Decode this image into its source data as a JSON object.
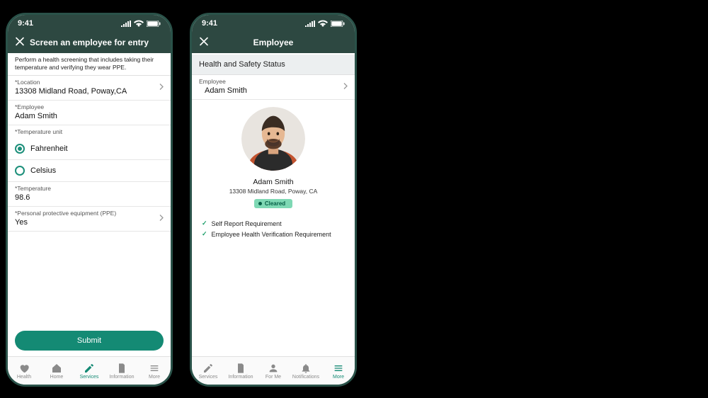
{
  "statusbar": {
    "time": "9:41"
  },
  "screen1": {
    "title": "Screen an employee for entry",
    "instructions": "Perform a health screening that includes taking their temperature and verifying they wear PPE.",
    "location_label": "*Location",
    "location_value": "13308 Midland Road, Poway,CA",
    "employee_label": "*Employee",
    "employee_value": "Adam Smith",
    "unit_label": "*Temperature unit",
    "unit_fahrenheit": "Fahrenheit",
    "unit_celsius": "Celsius",
    "temperature_label": "*Temperature",
    "temperature_value": "98.6",
    "ppe_label": "*Personal protective equipment (PPE)",
    "ppe_value": "Yes",
    "submit": "Submit",
    "tabs": {
      "health": "Health",
      "home": "Home",
      "services": "Services",
      "information": "Information",
      "more": "More"
    }
  },
  "screen2": {
    "title": "Employee",
    "section": "Health and Safety Status",
    "employee_label": "Employee",
    "employee_value": "Adam Smith",
    "profile_name": "Adam Smith",
    "profile_address": "13308 Midland Road, Poway, CA",
    "status": "Cleared",
    "req1": "Self Report Requirement",
    "req2": "Employee Health Verification Requirement",
    "tabs": {
      "services": "Services",
      "information": "Information",
      "forme": "For Me",
      "notifications": "Notifications",
      "more": "More"
    }
  }
}
